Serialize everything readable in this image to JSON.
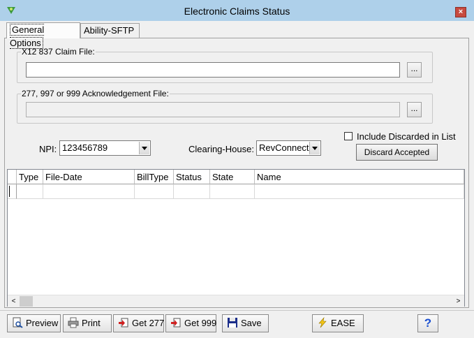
{
  "window": {
    "title": "Electronic Claims Status",
    "close_glyph": "×"
  },
  "tabs": [
    {
      "label": "General Options"
    },
    {
      "label": "Ability-SFTP"
    }
  ],
  "claim_file": {
    "label": "X12 837 Claim File:",
    "value": "",
    "browse": "..."
  },
  "ack_file": {
    "label": "277, 997 or 999 Acknowledgement File:",
    "value": "",
    "browse": "..."
  },
  "npi": {
    "label": "NPI:",
    "value": "123456789"
  },
  "clearing_house": {
    "label": "Clearing-House:",
    "value": "RevConnect"
  },
  "include_discarded": {
    "label": "Include Discarded in List",
    "checked": false
  },
  "discard_accepted": {
    "label": "Discard Accepted"
  },
  "grid": {
    "columns": [
      "Type",
      "File-Date",
      "BillType",
      "Status",
      "State",
      "Name"
    ],
    "rows": [],
    "scroll_left": "<",
    "scroll_right": ">"
  },
  "toolbar": {
    "preview": "Preview",
    "print": "Print",
    "get277": "Get 277",
    "get999": "Get 999",
    "save": "Save",
    "ease": "EASE",
    "help": "?"
  },
  "colors": {
    "titlebar": "#aed0ea",
    "accent_red": "#c74a3f",
    "help_blue": "#1a4fd0"
  }
}
